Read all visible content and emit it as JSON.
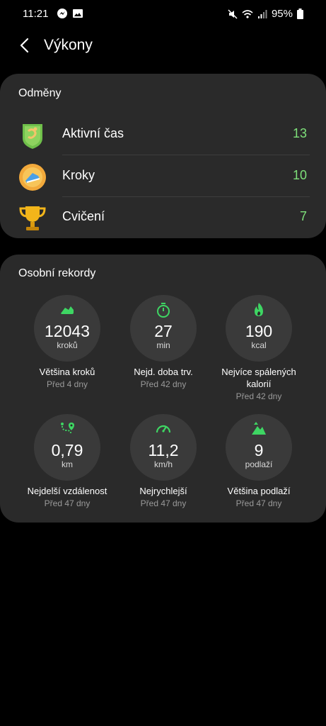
{
  "status": {
    "time": "11:21",
    "battery": "95%"
  },
  "header": {
    "title": "Výkony"
  },
  "rewards": {
    "title": "Odměny",
    "items": [
      {
        "label": "Aktivní čas",
        "value": "13",
        "icon": "active-time-badge-icon"
      },
      {
        "label": "Kroky",
        "value": "10",
        "icon": "steps-badge-icon"
      },
      {
        "label": "Cvičení",
        "value": "7",
        "icon": "trophy-icon"
      }
    ]
  },
  "records": {
    "title": "Osobní rekordy",
    "items": [
      {
        "value": "12043",
        "unit": "kroků",
        "label": "Většina kroků",
        "sub": "Před 4 dny",
        "icon": "shoe-icon"
      },
      {
        "value": "27",
        "unit": "min",
        "label": "Nejd. doba trv.",
        "sub": "Před 42 dny",
        "icon": "stopwatch-icon"
      },
      {
        "value": "190",
        "unit": "kcal",
        "label": "Nejvíce spálených kalorií",
        "sub": "Před 42 dny",
        "icon": "flame-icon"
      },
      {
        "value": "0,79",
        "unit": "km",
        "label": "Nejdelší vzdálenost",
        "sub": "Před 47 dny",
        "icon": "route-icon"
      },
      {
        "value": "11,2",
        "unit": "km/h",
        "label": "Nejrychlejší",
        "sub": "Před 47 dny",
        "icon": "speedometer-icon"
      },
      {
        "value": "9",
        "unit": "podlaží",
        "label": "Většina podlaží",
        "sub": "Před 47 dny",
        "icon": "mountain-icon"
      }
    ]
  },
  "colors": {
    "accent": "#7ee07a",
    "card": "#2a2a2a",
    "circle": "#3a3a3a"
  }
}
